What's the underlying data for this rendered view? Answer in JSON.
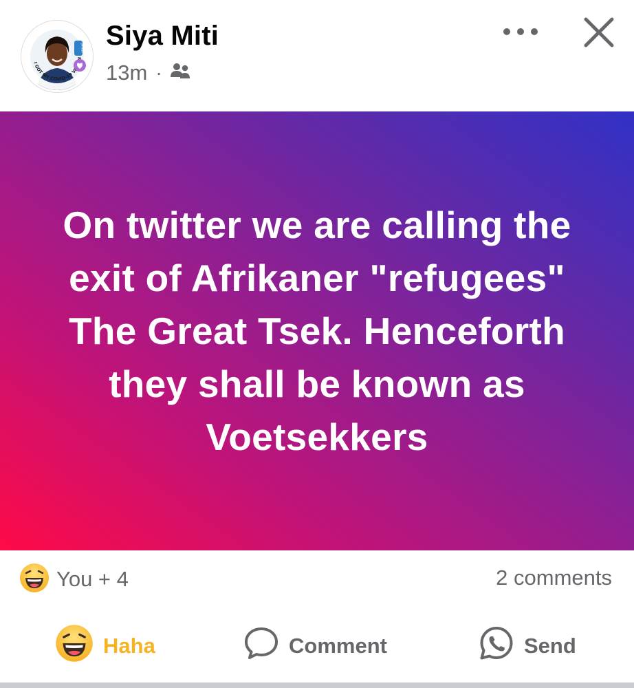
{
  "post": {
    "author": "Siya Miti",
    "time": "13m",
    "separator": "·",
    "audience_icon": "friends-icon",
    "avatar_frame_text": "I GOT MY COVID-19 VACCINE",
    "avatar_badge_text": "unicef",
    "body_text": "On twitter we are calling the exit of Afrikaner \"refugees\" The Great Tsek. Henceforth they shall be known as Voetsekkers",
    "background_colors": [
      "#ff0a47",
      "#8f1f92",
      "#3131c6"
    ]
  },
  "summary": {
    "reaction_icon": "haha-emoji-icon",
    "reactions_label": "You + 4",
    "comments_label": "2 comments"
  },
  "actions": {
    "haha_label": "Haha",
    "comment_label": "Comment",
    "send_label": "Send",
    "haha_color": "#f5b324",
    "muted_color": "#65676b"
  }
}
